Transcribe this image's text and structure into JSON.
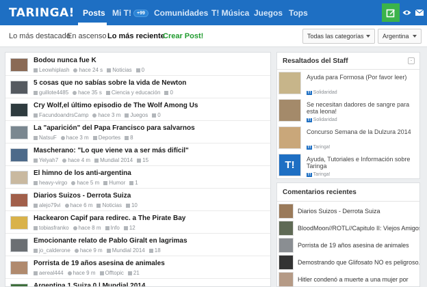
{
  "header": {
    "logo": "TARINGA!",
    "nav": [
      {
        "label": "Posts"
      },
      {
        "label": "Mi T!",
        "badge": "+99"
      },
      {
        "label": "Comunidades"
      },
      {
        "label": "T! Música"
      },
      {
        "label": "Juegos"
      },
      {
        "label": "Tops"
      }
    ]
  },
  "subnav": {
    "tabs": [
      "Lo más destacado",
      "En ascenso",
      "Lo más reciente",
      "Crear Post!"
    ],
    "category_select": "Todas las categorías",
    "country_select": "Argentina"
  },
  "posts": [
    {
      "title": "Bodou nunca fue K",
      "user": "Leowhiplash",
      "time": "hace 24 s",
      "category": "Noticias",
      "comments": "0",
      "thumb_color": "#8a6a55"
    },
    {
      "title": "5 cosas que no sabías sobre la vida de Newton",
      "user": "guillote4485",
      "time": "hace 35 s",
      "category": "Ciencia y educación",
      "comments": "0",
      "thumb_color": "#555a60"
    },
    {
      "title": "Cry Wolf,el último episodio de The Wolf Among Us",
      "user": "FacundoandrsCamp",
      "time": "hace 3 m",
      "category": "Juegos",
      "comments": "0",
      "thumb_color": "#2e3b3f"
    },
    {
      "title": "La \"aparición\" del Papa Francisco para salvarnos",
      "user": "NatsuF",
      "time": "hace 3 m",
      "category": "Deportes",
      "comments": "8",
      "thumb_color": "#7a8790"
    },
    {
      "title": "Mascherano: \"Lo que viene va a ser más difícil\"",
      "user": "Yelyah7",
      "time": "hace 4 m",
      "category": "Mundial 2014",
      "comments": "15",
      "thumb_color": "#4d6a8a"
    },
    {
      "title": "El himno de los anti-argentina",
      "user": "heavy-virgo",
      "time": "hace 5 m",
      "category": "Humor",
      "comments": "1",
      "thumb_color": "#c9b9a0"
    },
    {
      "title": "Diarios Suizos - Derrota Suiza",
      "user": "alejo79vi",
      "time": "hace 6 m",
      "category": "Noticias",
      "comments": "10",
      "thumb_color": "#a15f4a"
    },
    {
      "title": "Hackearon Capif para redirec. a The Pirate Bay",
      "user": "tobiasfranko",
      "time": "hace 8 m",
      "category": "Info",
      "comments": "12",
      "thumb_color": "#d9b24a"
    },
    {
      "title": "Emocionante relato de Pablo Giralt en lagrimas",
      "user": "jo_calderone",
      "time": "hace 9 m",
      "category": "Mundial 2014",
      "comments": "18",
      "thumb_color": "#6b6f73"
    },
    {
      "title": "Porrista de 19 años asesina de animales",
      "user": "aereal444",
      "time": "hace 9 m",
      "category": "Offtopic",
      "comments": "21",
      "thumb_color": "#b08a6e"
    },
    {
      "title": "Argentina 1 Suiza 0 | Mundial 2014",
      "user": "",
      "time": "",
      "category": "",
      "comments": "",
      "thumb_color": "#3f6f3c"
    }
  ],
  "staff": {
    "title": "Resaltados del Staff",
    "collapse_symbol": "-",
    "items": [
      {
        "title": "Ayuda para Formosa (Por favor leer)",
        "category": "Solidaridad",
        "thumb_color": "#c7b58a"
      },
      {
        "title": "Se necesitan dadores de sangre para esta leona!",
        "category": "Solidaridad",
        "thumb_color": "#a48a6a"
      },
      {
        "title": "Concurso Semana de la Dulzura 2014",
        "category": "Taringa!",
        "thumb_color": "#c9a77a"
      },
      {
        "title": "Ayuda, Tutoriales e Información sobre Taringa",
        "category": "Taringa!",
        "thumb_color": "#1e6fc3",
        "thumb_text": "T!"
      }
    ]
  },
  "comments_panel": {
    "title": "Comentarios recientes",
    "items": [
      {
        "text": "Diarios Suizos - Derrota Suiza",
        "thumb_color": "#9a7a5a"
      },
      {
        "text": "BloodMoon//ROTL//Capitulo II: Viejos Amigos,",
        "thumb_color": "#5f6a55"
      },
      {
        "text": "Porrista de 19 años asesina de animales",
        "thumb_color": "#8a8e92"
      },
      {
        "text": "Demostrando que Glifosato NO es peligroso.",
        "thumb_color": "#333333"
      },
      {
        "text": "Hitler condenó a muerte a una mujer por",
        "thumb_color": "#b59a86"
      }
    ]
  },
  "colors": {
    "brand": "#1e6fc3",
    "accent_green": "#3bb34a",
    "create_post": "#1f9b2e"
  }
}
